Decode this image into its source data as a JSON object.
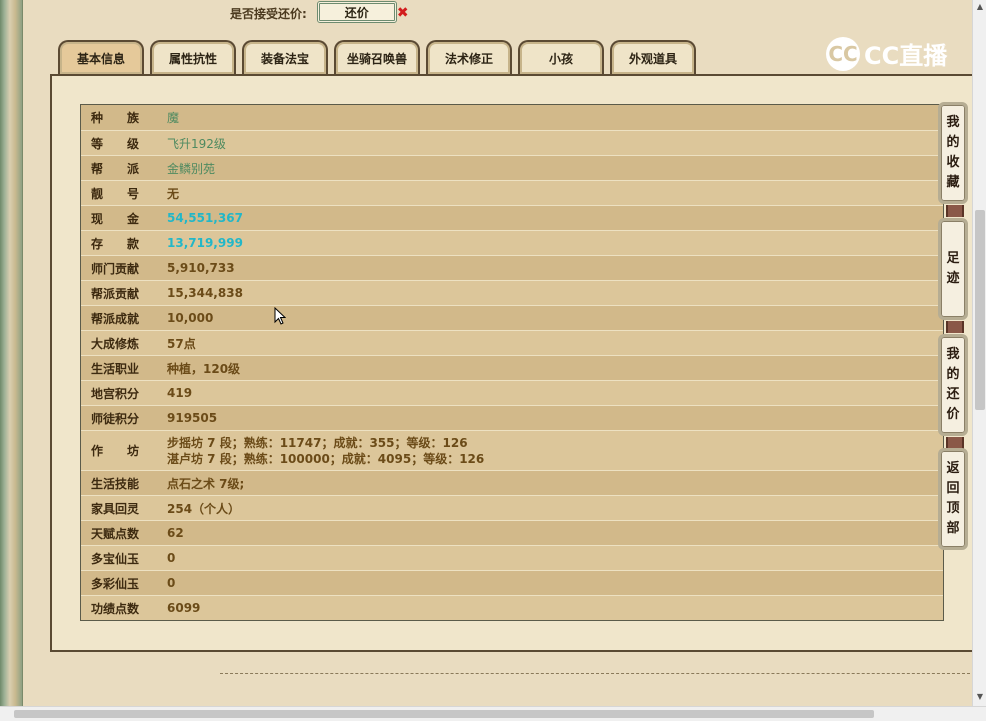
{
  "top": {
    "accept_counter_label": "是否接受还价:",
    "counter_button": "还价",
    "close_icon": "✖"
  },
  "brand": {
    "logo_text": "CC直播",
    "logo_glyph": "CC"
  },
  "tabs": [
    {
      "label": "基本信息",
      "active": true
    },
    {
      "label": "属性抗性"
    },
    {
      "label": "装备法宝"
    },
    {
      "label": "坐骑召唤兽"
    },
    {
      "label": "法术修正"
    },
    {
      "label": "小孩"
    },
    {
      "label": "外观道具"
    }
  ],
  "info_rows": [
    {
      "key": "种　　族",
      "value": "魔",
      "style": "green"
    },
    {
      "key": "等　　级",
      "value": "飞升192级",
      "style": "green"
    },
    {
      "key": "帮　　派",
      "value": "金鳞别苑",
      "style": "green"
    },
    {
      "key": "靓　　号",
      "value": "无",
      "style": "normal"
    },
    {
      "key": "现　　金",
      "value": "54,551,367",
      "style": "cyan"
    },
    {
      "key": "存　　款",
      "value": "13,719,999",
      "style": "cyan"
    },
    {
      "key": "师门贡献",
      "value": "5,910,733",
      "style": "normal"
    },
    {
      "key": "帮派贡献",
      "value": "15,344,838",
      "style": "normal"
    },
    {
      "key": "帮派成就",
      "value": "10,000",
      "style": "normal"
    },
    {
      "key": "大成修炼",
      "value": "57点",
      "style": "normal"
    },
    {
      "key": "生活职业",
      "value": "种植，120级",
      "style": "normal"
    },
    {
      "key": "地宫积分",
      "value": "419",
      "style": "normal"
    },
    {
      "key": "师徒积分",
      "value": "919505",
      "style": "normal"
    },
    {
      "key": "作　　坊",
      "value": "步摇坊 7 段；熟练：11747；成就：355；等级：126",
      "value2": "湛卢坊 7 段；熟练：100000；成就：4095；等级：126",
      "style": "normal",
      "tall": true
    },
    {
      "key": "生活技能",
      "value": "点石之术 7级;",
      "style": "normal"
    },
    {
      "key": "家具回灵",
      "value": "254（个人）",
      "style": "normal"
    },
    {
      "key": "天赋点数",
      "value": "62",
      "style": "normal"
    },
    {
      "key": "多宝仙玉",
      "value": "0",
      "style": "normal"
    },
    {
      "key": "多彩仙玉",
      "value": "0",
      "style": "normal"
    },
    {
      "key": "功绩点数",
      "value": "6099",
      "style": "normal"
    }
  ],
  "side_buttons": [
    {
      "chars": [
        "我",
        "的",
        "收",
        "藏"
      ]
    },
    {
      "chars": [
        "足",
        "迹"
      ]
    },
    {
      "chars": [
        "我",
        "的",
        "还",
        "价"
      ]
    },
    {
      "chars": [
        "返",
        "回",
        "顶",
        "部"
      ]
    }
  ]
}
